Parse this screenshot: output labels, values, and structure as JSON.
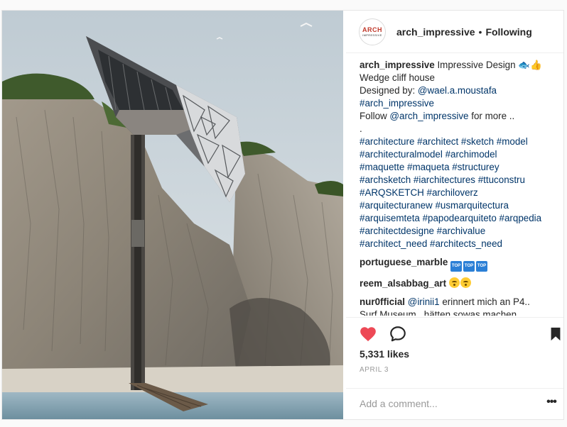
{
  "post": {
    "image_alt": "Wedge cliff house rendering",
    "header": {
      "avatar_line1": "ARCH",
      "avatar_line2": "IMPRESSIVE",
      "username": "arch_impressive",
      "separator": "•",
      "follow_state": "Following"
    },
    "caption": {
      "username": "arch_impressive",
      "lines": [
        " Impressive Design 🐟👍",
        "Wedge cliff house",
        "Designed by: ",
        "@wael.a.moustafa",
        "#arch_impressive",
        "Follow ",
        "@arch_impressive",
        " for more ..",
        "."
      ],
      "hashtag_lines": [
        "#architecture #architect #sketch #model",
        "#architecturalmodel #archimodel",
        "#maquette #maqueta #structurey",
        "#archsketch #iarchitectures #ttuconstru",
        "#ARQSKETCH #archiloverz",
        "#arquitecturanew #usmarquitectura",
        "#arquisemteta #papodearquiteto #arqpedia",
        "#architectdesigne #archivalue",
        "#architect_need #architects_need"
      ]
    },
    "comments": [
      {
        "username": "portuguese_marble",
        "text": "",
        "emoji": [
          "TOP",
          "TOP",
          "TOP"
        ]
      },
      {
        "username": "reem_alsabbag_art",
        "text": "",
        "emoji_faces": 2
      },
      {
        "username": "nur0fficial",
        "mention": "@irinii1",
        "text": " erinnert mich an P4..",
        "text2": "Surf Museum.. hätten sowas machen"
      }
    ],
    "actions": {
      "like_icon": "heart-icon",
      "comment_icon": "comment-icon",
      "save_icon": "bookmark-icon",
      "liked_color": "#ed4956"
    },
    "likes": "5,331 likes",
    "date": "APRIL 3",
    "add_comment_placeholder": "Add a comment...",
    "more_label": "•••"
  }
}
